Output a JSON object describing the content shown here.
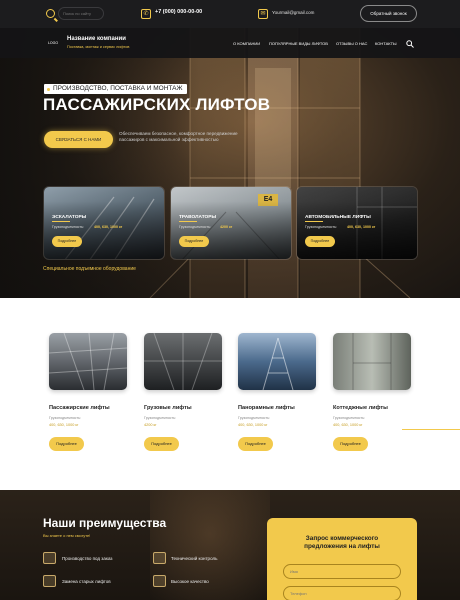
{
  "topbar": {
    "search_placeholder": "Поиск по сайту",
    "phone": "+7 (000) 000-00-00",
    "email": "Yourmail@gmail.com",
    "callback_label": "Обратный звонок"
  },
  "nav": {
    "logo": "LOGO",
    "company_name": "Название компании",
    "company_subtitle": "Поставка, монтаж и сервис лифтов",
    "items": [
      "О КОМПАНИИ",
      "ПОПУЛЯРНЫЕ ВИДЫ ЛИФТОВ",
      "ОТЗЫВЫ О НАС",
      "КОНТАКТЫ"
    ],
    "search_icon": "search-icon"
  },
  "hero": {
    "badge": "ПРОИЗВОДСТВО, ПОСТАВКА И МОНТАЖ",
    "title": "ПАССАЖИРСКИХ ЛИФТОВ",
    "cta": "СВЯЗАТЬСЯ С НАМИ",
    "description": "Обеспечиваем безопасное, комфортное передвижение пассажиров с максимальной эффективностью"
  },
  "categories": [
    {
      "title": "ЭСКАЛАТОРЫ",
      "cap_label": "Грузоподъемность:",
      "cap_value": "400, 630, 1000 кг",
      "more": "Подробнее"
    },
    {
      "title": "ТРАВОЛАТОРЫ",
      "cap_label": "Грузоподъемность:",
      "cap_value": "4200 кг",
      "more": "Подробнее",
      "sign": "E4"
    },
    {
      "title": "АВТОМОБИЛЬНЫЕ ЛИФТЫ",
      "cap_label": "Грузоподъемность:",
      "cap_value": "400, 630, 1000 кг",
      "more": "Подробнее"
    }
  ],
  "special_link": "Специальное подъемное оборудование",
  "products": [
    {
      "name": "Пассажирские лифты",
      "cap_label": "Грузоподъемность:",
      "cap_value": "400, 630, 1000 кг",
      "more": "Подробнее"
    },
    {
      "name": "Грузовые лифты",
      "cap_label": "Грузоподъемность:",
      "cap_value": "4200 кг",
      "more": "Подробнее"
    },
    {
      "name": "Панорамные лифты",
      "cap_label": "Грузоподъемность:",
      "cap_value": "400, 630, 1000 кг",
      "more": "Подробнее"
    },
    {
      "name": "Коттеджные лифты",
      "cap_label": "Грузоподъемность:",
      "cap_value": "400, 630, 1000 кг",
      "more": "Подробнее"
    }
  ],
  "advantages": {
    "title": "Наши преимущества",
    "subtitle": "Вы знаете о нем смогуте!",
    "items": [
      "Производство под заказ",
      "Технический контроль",
      "Замена старых лифтов",
      "Высокое качество"
    ]
  },
  "form": {
    "title_line1": "Запрос коммерческого",
    "title_line2": "предложения на лифты",
    "name_placeholder": "Имя",
    "phone_placeholder": "Телефон"
  },
  "colors": {
    "accent": "#f2c94c",
    "dark": "#1c1c1e"
  }
}
